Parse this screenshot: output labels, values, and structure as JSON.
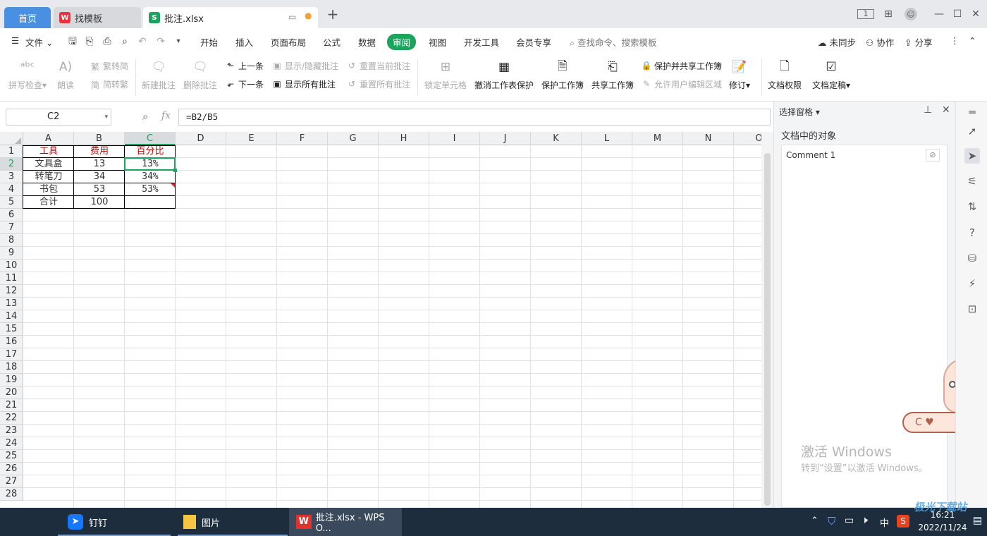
{
  "tabs": {
    "home": "首页",
    "template": "找模板",
    "file": "批注.xlsx"
  },
  "menu": {
    "file": "文件",
    "items": [
      "开始",
      "插入",
      "页面布局",
      "公式",
      "数据",
      "审阅",
      "视图",
      "开发工具",
      "会员专享"
    ],
    "search_placeholder": "查找命令、搜索模板",
    "sync": "未同步",
    "collab": "协作",
    "share": "分享"
  },
  "ribbon": {
    "spell_check": "拼写检查",
    "read_aloud": "朗读",
    "trad_simp": "繁转简",
    "simp_trad": "简转繁",
    "new_comment": "新建批注",
    "delete_comment": "删除批注",
    "prev": "上一条",
    "next": "下一条",
    "show_hide": "显示/隐藏批注",
    "show_all": "显示所有批注",
    "reset_current": "重置当前批注",
    "reset_all": "重置所有批注",
    "lock_cell": "锁定单元格",
    "unprotect_sheet": "撤消工作表保护",
    "protect_workbook": "保护工作簿",
    "share_workbook": "共享工作簿",
    "protect_share": "保护并共享工作簿",
    "allow_edit": "允许用户编辑区域",
    "revise": "修订",
    "doc_permission": "文档权限",
    "doc_final": "文档定稿"
  },
  "formula_bar": {
    "name_box": "C2",
    "fx": "fx",
    "formula": "=B2/B5"
  },
  "sheet": {
    "columns": [
      "A",
      "B",
      "C",
      "D",
      "E",
      "F",
      "G",
      "H",
      "I",
      "J",
      "K",
      "L",
      "M",
      "N",
      "O"
    ],
    "row_numbers": [
      "1",
      "2",
      "3",
      "4",
      "5",
      "6",
      "7",
      "8",
      "9",
      "10",
      "11",
      "12",
      "13",
      "14",
      "15",
      "16",
      "17",
      "18",
      "19",
      "20",
      "21",
      "22",
      "23",
      "24",
      "25",
      "26",
      "27",
      "28"
    ],
    "header": [
      "工具",
      "费用",
      "百分比"
    ],
    "rows": [
      [
        "文具盒",
        "13",
        "13%"
      ],
      [
        "转笔刀",
        "34",
        "34%"
      ],
      [
        "书包",
        "53",
        "53%"
      ],
      [
        "合计",
        "100",
        ""
      ]
    ],
    "selected_cell": "C2",
    "comment_cell": "C4",
    "header_color": "#c00000"
  },
  "selection_pane": {
    "title": "选择窗格",
    "objects_heading": "文档中的对象",
    "objects": [
      "Comment 1"
    ]
  },
  "watermark": {
    "title": "激活 Windows",
    "subtitle": "转到“设置”以激活 Windows。"
  },
  "taskbar": {
    "dingtalk": "钉钉",
    "pictures": "图片",
    "wps": "批注.xlsx - WPS O...",
    "ime": "中",
    "time": "16:21",
    "date": "2022/11/24",
    "site_watermark": "极光下载站"
  },
  "colors": {
    "accent_green": "#1aa45d",
    "home_tab": "#4a90e2",
    "taskbar": "#1d2d3e"
  }
}
